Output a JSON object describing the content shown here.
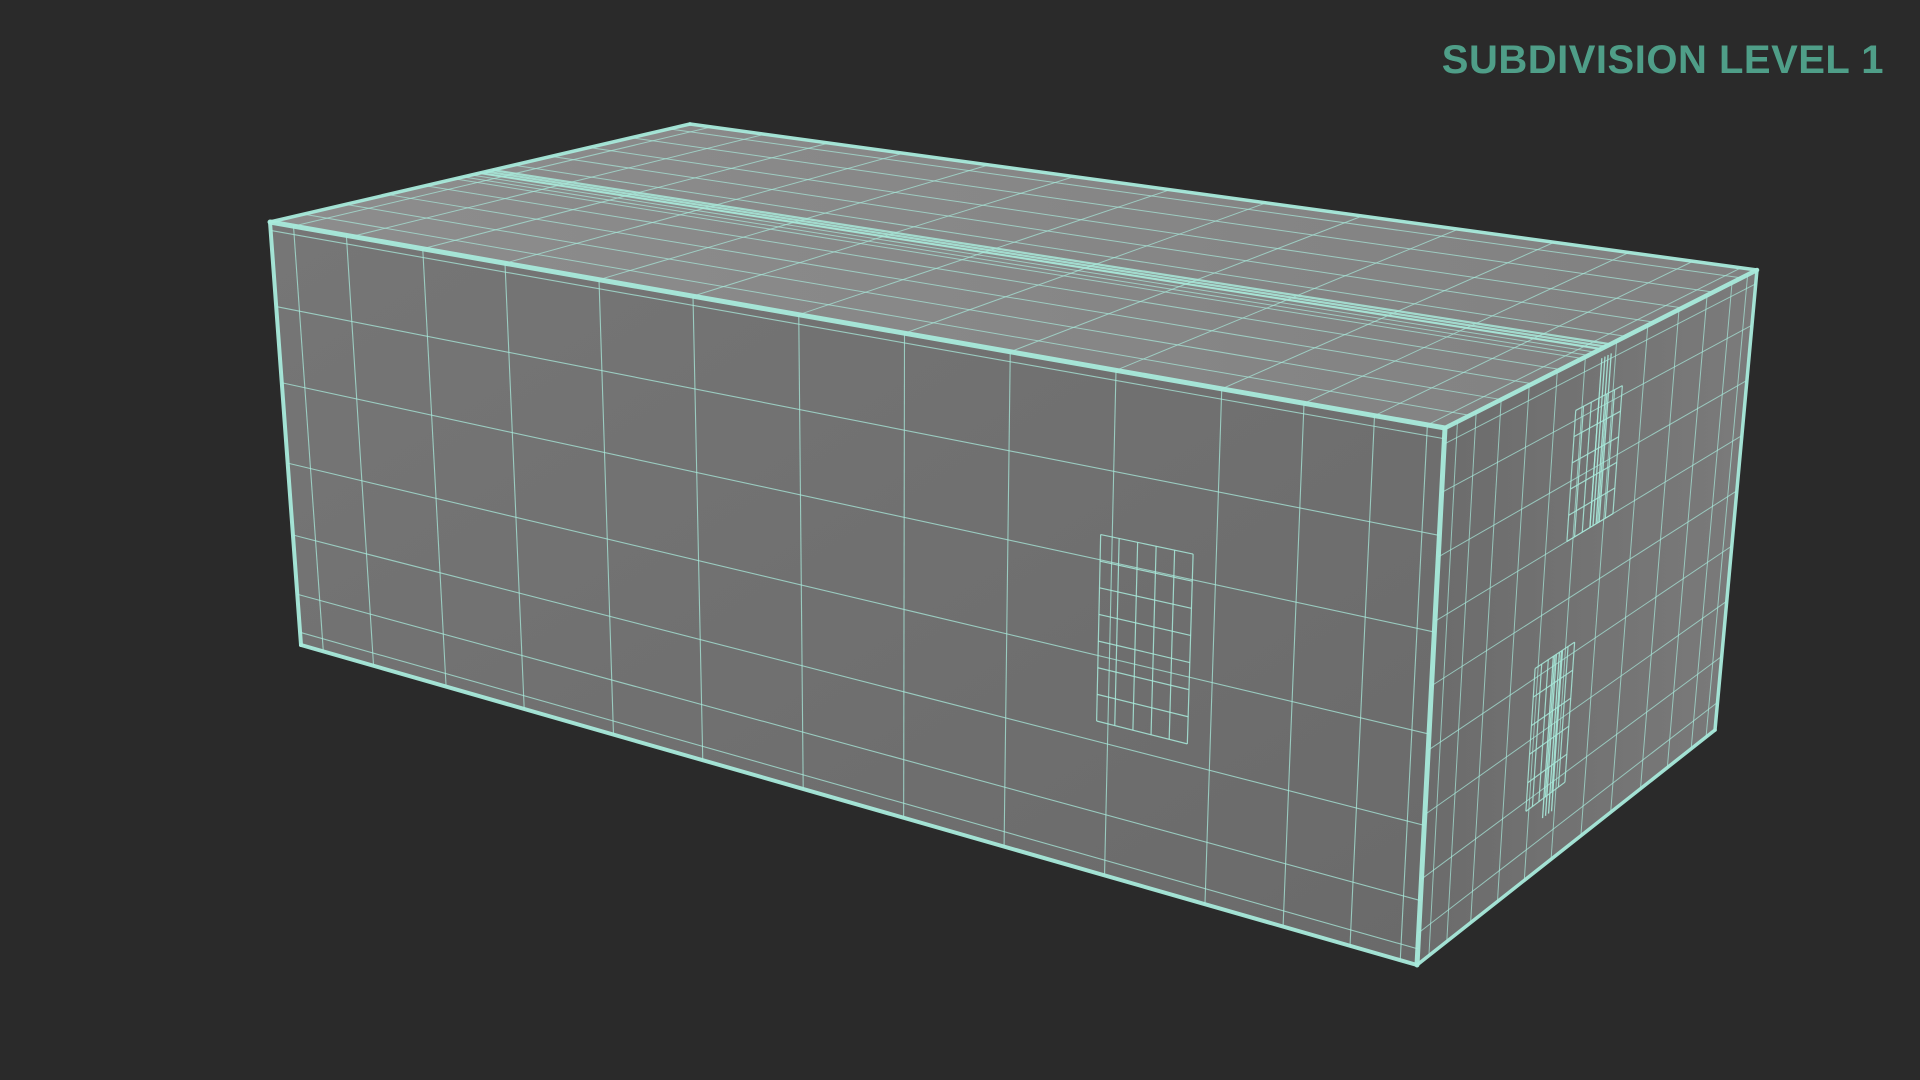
{
  "viewport": {
    "overlay_label": "SUBDIVISION LEVEL 1",
    "colors": {
      "background": "#2a2a2a",
      "label": "#4f9e88",
      "wire": "#a8eadb",
      "front_face": "#777777",
      "top_face": "#8a8a8a",
      "side_face": "#6e6e6e"
    },
    "model": {
      "subject": "box-wireframe",
      "subdivision_level": 1
    }
  }
}
